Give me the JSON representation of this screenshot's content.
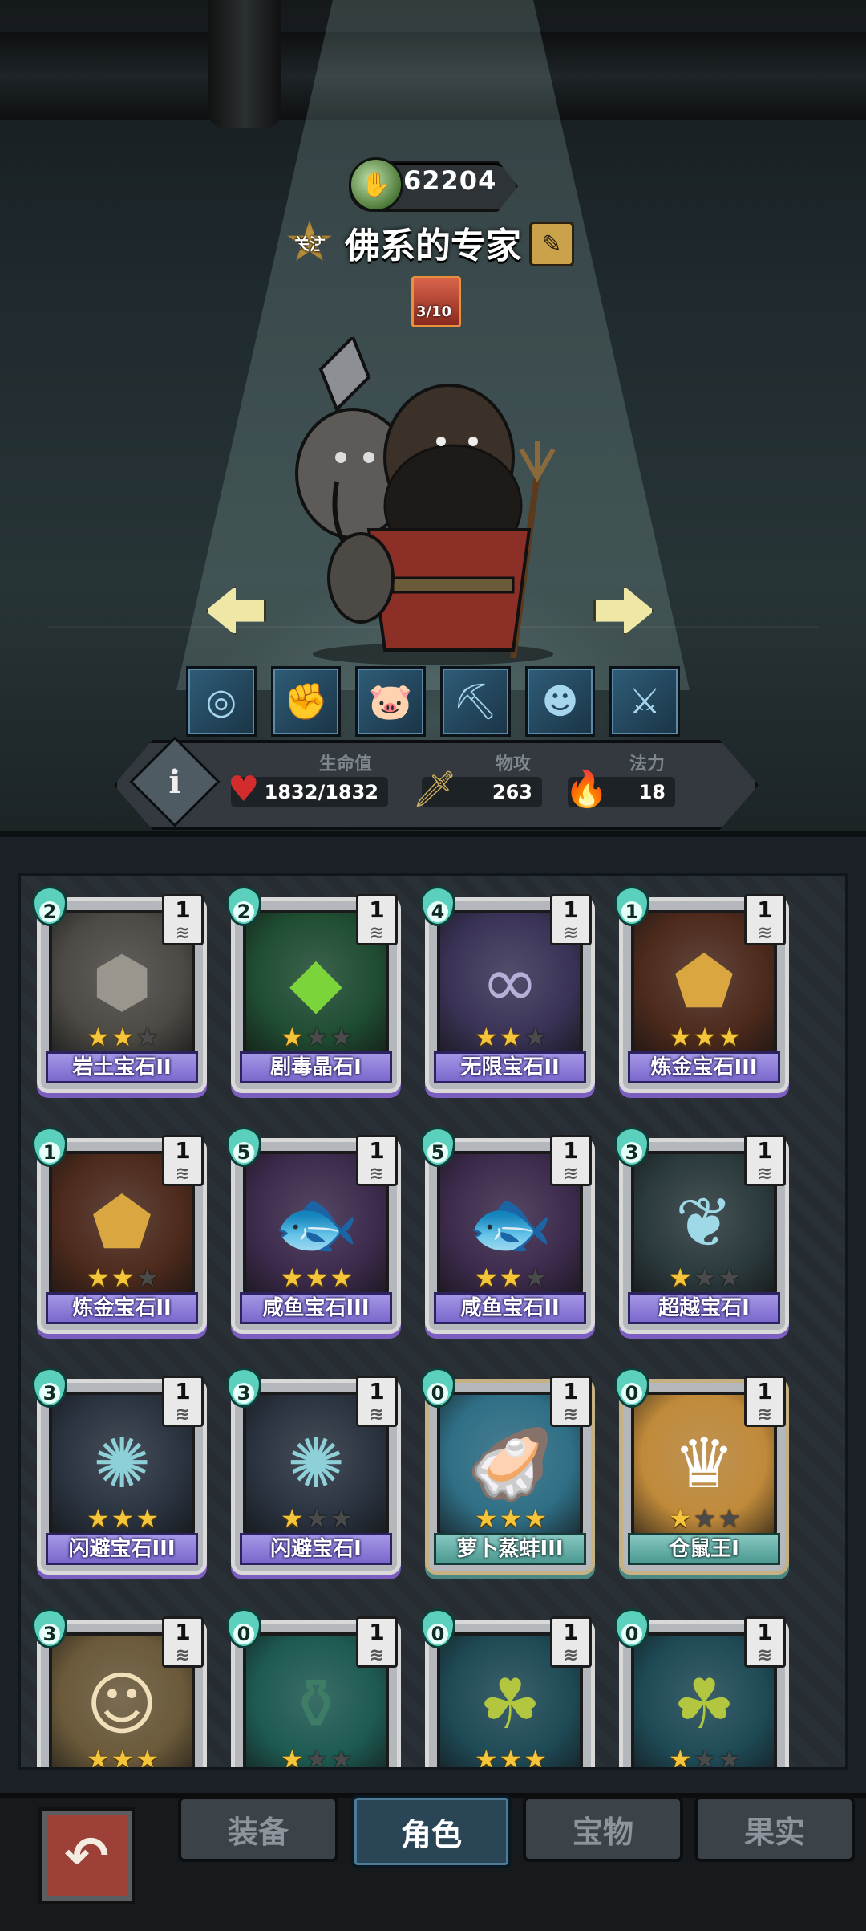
{
  "header": {
    "score": "62204",
    "follow_label": "关注",
    "hero_name": "佛系的专家",
    "badge_progress": "3/10"
  },
  "skills": [
    "vortex-skill-icon",
    "fist-skill-icon",
    "pig-skill-icon",
    "pickaxe-skill-icon",
    "pumpkin-skill-icon",
    "crossed-swords-skill-icon"
  ],
  "stats": {
    "hp_label": "生命值",
    "hp_value": "1832/1832",
    "atk_label": "物攻",
    "atk_value": "263",
    "magic_label": "法力",
    "magic_value": "18"
  },
  "cards": [
    {
      "name": "岩土宝石II",
      "cost": "2",
      "level": "1",
      "stars": 2,
      "rarity": "epic",
      "icon": "rock-gem-icon"
    },
    {
      "name": "剧毒晶石I",
      "cost": "2",
      "level": "1",
      "stars": 1,
      "rarity": "epic",
      "icon": "poison-crystal-icon"
    },
    {
      "name": "无限宝石II",
      "cost": "4",
      "level": "1",
      "stars": 2,
      "rarity": "epic",
      "icon": "infinity-gem-icon"
    },
    {
      "name": "炼金宝石III",
      "cost": "1",
      "level": "1",
      "stars": 3,
      "rarity": "epic",
      "icon": "alchemy-gem-icon"
    },
    {
      "name": "炼金宝石II",
      "cost": "1",
      "level": "1",
      "stars": 2,
      "rarity": "epic",
      "icon": "alchemy-gem-icon"
    },
    {
      "name": "咸鱼宝石III",
      "cost": "5",
      "level": "1",
      "stars": 3,
      "rarity": "epic",
      "icon": "salted-fish-gem-icon"
    },
    {
      "name": "咸鱼宝石II",
      "cost": "5",
      "level": "1",
      "stars": 2,
      "rarity": "epic",
      "icon": "salted-fish-gem-icon"
    },
    {
      "name": "超越宝石I",
      "cost": "3",
      "level": "1",
      "stars": 1,
      "rarity": "epic",
      "icon": "transcend-gem-icon"
    },
    {
      "name": "闪避宝石III",
      "cost": "3",
      "level": "1",
      "stars": 3,
      "rarity": "epic",
      "icon": "dodge-gem-icon"
    },
    {
      "name": "闪避宝石I",
      "cost": "3",
      "level": "1",
      "stars": 1,
      "rarity": "epic",
      "icon": "dodge-gem-icon"
    },
    {
      "name": "萝卜蒸蚌III",
      "cost": "0",
      "level": "1",
      "stars": 3,
      "rarity": "legend",
      "icon": "carrot-clam-icon"
    },
    {
      "name": "仓鼠王I",
      "cost": "0",
      "level": "1",
      "stars": 1,
      "rarity": "legend",
      "icon": "hamster-king-icon"
    },
    {
      "name": "",
      "cost": "3",
      "level": "1",
      "stars": 3,
      "rarity": "epic",
      "icon": "portrait-card-icon"
    },
    {
      "name": "",
      "cost": "0",
      "level": "1",
      "stars": 1,
      "rarity": "epic",
      "icon": "potion-bottle-icon"
    },
    {
      "name": "",
      "cost": "0",
      "level": "1",
      "stars": 3,
      "rarity": "epic",
      "icon": "clover-coin-icon"
    },
    {
      "name": "",
      "cost": "0",
      "level": "1",
      "stars": 1,
      "rarity": "epic",
      "icon": "clover-coin-icon"
    }
  ],
  "tabs": [
    "装备",
    "角色",
    "宝物",
    "果实"
  ],
  "active_tab": "角色"
}
